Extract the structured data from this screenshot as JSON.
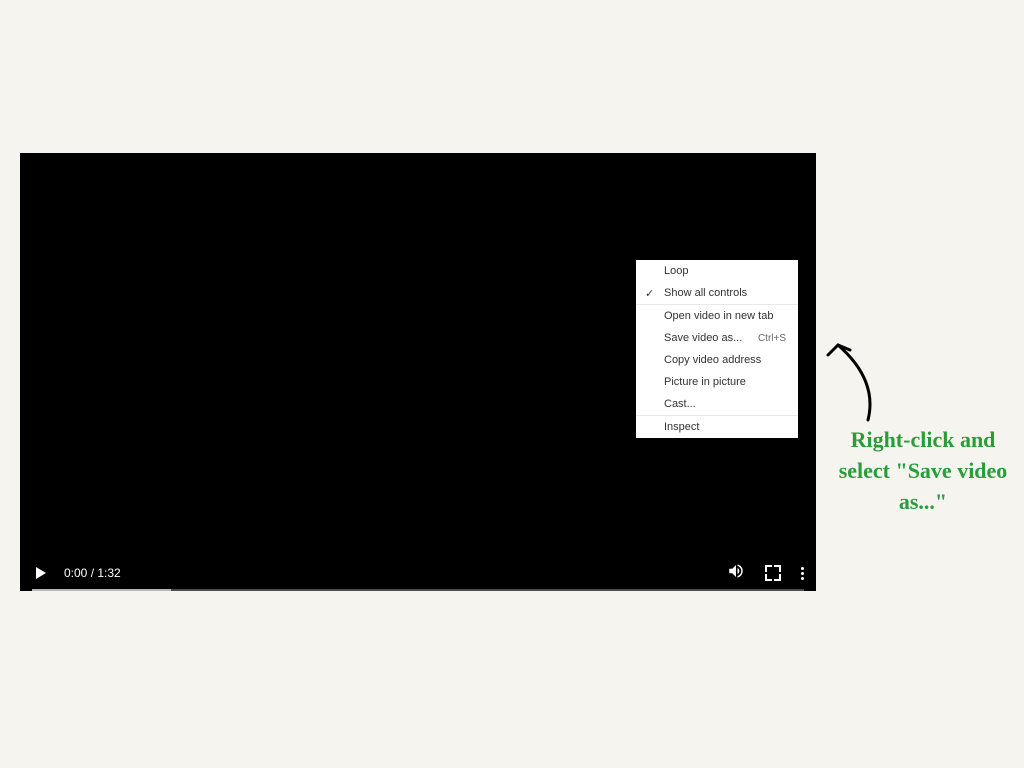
{
  "video": {
    "time_current": "0:00",
    "time_total": "1:32",
    "time_display": "0:00 / 1:32"
  },
  "context_menu": {
    "section1": {
      "loop": "Loop",
      "show_controls": "Show all controls"
    },
    "section2": {
      "open_new_tab": "Open video in new tab",
      "save_as": "Save video as...",
      "save_as_shortcut": "Ctrl+S",
      "copy_address": "Copy video address",
      "pip": "Picture in picture",
      "cast": "Cast..."
    },
    "section3": {
      "inspect": "Inspect"
    }
  },
  "annotation": {
    "text": "Right-click and select \"Save video as...\""
  }
}
